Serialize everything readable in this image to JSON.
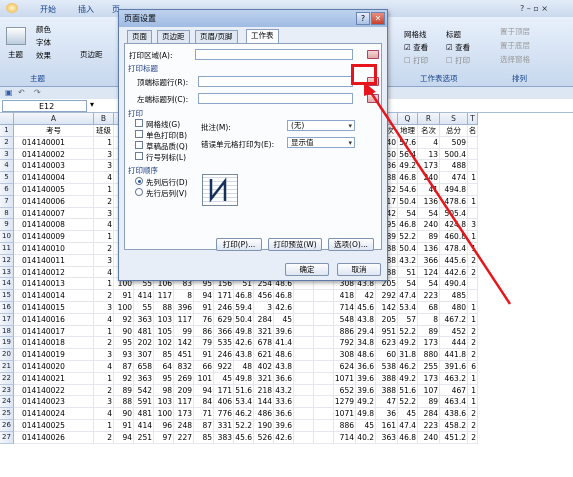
{
  "ribbon": {
    "tabs": [
      "开始",
      "插入",
      "页"
    ],
    "groups": {
      "theme": "主题",
      "sheet_options": "工作表选项",
      "arrange": "排列"
    },
    "theme_btn": "主题",
    "colors": "颜色",
    "fonts": "字体",
    "effects": "效果",
    "margins": "页边距",
    "gridlines": "网格线",
    "headings": "标题",
    "view1": "查看",
    "view2": "查看",
    "print1": "打印",
    "print2": "打印",
    "bring_front": "置于顶层",
    "send_back": "置于底层",
    "selection_pane": "选择窗格"
  },
  "formula_bar": {
    "namebox": "E12"
  },
  "dialog": {
    "title": "页面设置",
    "tabs": [
      "页面",
      "页边距",
      "页眉/页脚",
      "工作表"
    ],
    "print_area": "打印区域(A):",
    "print_titles": "打印标题",
    "top_rows": "顶端标题行(R):",
    "left_cols": "左端标题列(C):",
    "print_section": "打印",
    "gridlines": "网格线(G)",
    "bw": "单色打印(B)",
    "draft": "草稿品质(Q)",
    "rowcol": "行号列标(L)",
    "comments_label": "批注(M):",
    "comments_value": "(无)",
    "errors_label": "错误单元格打印为(E):",
    "errors_value": "显示值",
    "order_section": "打印顺序",
    "down_then_over": "先列后行(D)",
    "over_then_down": "先行后列(V)",
    "print_btn": "打印(P)...",
    "preview_btn": "打印预览(W)",
    "options_btn": "选项(O)...",
    "ok": "确定",
    "cancel": "取消"
  },
  "sheet": {
    "columns": [
      "A",
      "B",
      "C",
      "D",
      "E",
      "F",
      "G",
      "H",
      "I",
      "J",
      "K",
      "L",
      "M",
      "N",
      "O",
      "P",
      "Q",
      "R",
      "S",
      "T"
    ],
    "header_row": [
      "考号",
      "班级",
      "",
      "",
      "",
      "",
      "",
      "",
      "",
      "",
      "",
      "",
      "",
      "名次",
      "历史",
      "名次",
      "地理",
      "名次",
      "总分",
      "名"
    ],
    "rows": [
      [
        "014140001",
        "1",
        "",
        "",
        "",
        "",
        "",
        "",
        "",
        "",
        "",
        "",
        "",
        "571",
        "80.3",
        "340",
        "57.6",
        "4",
        "509",
        ""
      ],
      [
        "014140002",
        "3",
        "",
        "",
        "",
        "",
        "",
        "",
        "",
        "",
        "",
        "",
        "",
        "398",
        "51.4",
        "450",
        "56.4",
        "13",
        "500.4",
        ""
      ],
      [
        "014140003",
        "3",
        "",
        "",
        "",
        "",
        "",
        "",
        "",
        "",
        "",
        "",
        "",
        "548",
        "49.8",
        "36",
        "49.2",
        "173",
        "488",
        ""
      ],
      [
        "014140004",
        "4",
        "",
        "",
        "",
        "",
        "",
        "",
        "",
        "",
        "",
        "",
        "",
        "334",
        "39.8",
        "388",
        "46.8",
        "240",
        "474",
        "1"
      ],
      [
        "014140005",
        "1",
        "",
        "",
        "",
        "",
        "",
        "",
        "",
        "",
        "",
        "",
        "",
        "172",
        "44.4",
        "182",
        "54.6",
        "41",
        "494.8",
        ""
      ],
      [
        "014140006",
        "2",
        "",
        "",
        "",
        "",
        "",
        "",
        "",
        "",
        "",
        "",
        "",
        "930",
        "41.4",
        "317",
        "50.4",
        "136",
        "478.6",
        "1"
      ],
      [
        "014140007",
        "3",
        "",
        "",
        "",
        "",
        "",
        "",
        "",
        "",
        "",
        "",
        "",
        "398",
        "45.6",
        "42",
        "54",
        "54",
        "505.4",
        ""
      ],
      [
        "014140008",
        "4",
        "",
        "",
        "",
        "",
        "",
        "",
        "",
        "",
        "",
        "",
        "",
        "334",
        "29.4",
        "95",
        "46.8",
        "240",
        "424.8",
        "3"
      ],
      [
        "014140009",
        "1",
        "",
        "",
        "",
        "",
        "",
        "",
        "",
        "",
        "",
        "",
        "",
        "418",
        "35.4",
        "589",
        "52.2",
        "89",
        "460.8",
        "1"
      ],
      [
        "014140010",
        "2",
        "",
        "",
        "",
        "",
        "",
        "",
        "",
        "",
        "",
        "",
        "",
        "501",
        "39.6",
        "388",
        "50.4",
        "136",
        "478.4",
        "1"
      ],
      [
        "014140011",
        "3",
        "90",
        "481",
        "100",
        "73",
        "81",
        "497",
        "41.1",
        "431",
        "44.4",
        "",
        "",
        "571",
        "39.6",
        "388",
        "43.2",
        "366",
        "445.6",
        "2"
      ],
      [
        "014140012",
        "4",
        "98",
        "104",
        "59",
        "913",
        "87",
        "331",
        "56.4",
        "48",
        "51.6",
        "",
        "",
        "129",
        "39.6",
        "388",
        "51",
        "124",
        "442.6",
        "2"
      ],
      [
        "014140013",
        "1",
        "100",
        "55",
        "106",
        "83",
        "95",
        "156",
        "51",
        "254",
        "48.6",
        "",
        "",
        "308",
        "43.8",
        "205",
        "54",
        "54",
        "490.4",
        ""
      ],
      [
        "014140014",
        "2",
        "91",
        "414",
        "117",
        "8",
        "94",
        "171",
        "46.8",
        "456",
        "46.8",
        "",
        "",
        "418",
        "42",
        "292",
        "47.4",
        "223",
        "485",
        ""
      ],
      [
        "014140015",
        "3",
        "100",
        "55",
        "88",
        "396",
        "91",
        "246",
        "59.4",
        "3",
        "42.6",
        "",
        "",
        "714",
        "45.6",
        "142",
        "53.4",
        "68",
        "480",
        "1"
      ],
      [
        "014140016",
        "4",
        "92",
        "363",
        "103",
        "117",
        "76",
        "629",
        "50.4",
        "284",
        "45",
        "",
        "",
        "548",
        "43.8",
        "205",
        "57",
        "8",
        "467.2",
        "1"
      ],
      [
        "014140017",
        "1",
        "90",
        "481",
        "105",
        "99",
        "86",
        "366",
        "49.8",
        "321",
        "39.6",
        "",
        "",
        "886",
        "29.4",
        "951",
        "52.2",
        "89",
        "452",
        "2"
      ],
      [
        "014140018",
        "2",
        "95",
        "202",
        "102",
        "142",
        "79",
        "535",
        "42.6",
        "678",
        "41.4",
        "",
        "",
        "792",
        "34.8",
        "623",
        "49.2",
        "173",
        "444",
        "2"
      ],
      [
        "014140019",
        "3",
        "93",
        "307",
        "85",
        "451",
        "91",
        "246",
        "43.8",
        "621",
        "48.6",
        "",
        "",
        "308",
        "48.6",
        "60",
        "31.8",
        "880",
        "441.8",
        "2"
      ],
      [
        "014140020",
        "4",
        "87",
        "658",
        "64",
        "832",
        "66",
        "922",
        "48",
        "402",
        "43.8",
        "",
        "",
        "624",
        "36.6",
        "538",
        "46.2",
        "255",
        "391.6",
        "6"
      ],
      [
        "014140021",
        "1",
        "92",
        "363",
        "95",
        "269",
        "101",
        "45",
        "49.8",
        "321",
        "36.6",
        "",
        "",
        "1071",
        "39.6",
        "388",
        "49.2",
        "173",
        "463.2",
        "1"
      ],
      [
        "014140022",
        "2",
        "89",
        "542",
        "98",
        "209",
        "94",
        "171",
        "51.6",
        "218",
        "43.2",
        "",
        "",
        "652",
        "39.6",
        "388",
        "51.6",
        "107",
        "467",
        "1"
      ],
      [
        "014140023",
        "3",
        "88",
        "591",
        "103",
        "117",
        "84",
        "406",
        "53.4",
        "144",
        "33.6",
        "",
        "",
        "1279",
        "49.2",
        "47",
        "52.2",
        "89",
        "463.4",
        "1"
      ],
      [
        "014140024",
        "4",
        "90",
        "481",
        "100",
        "173",
        "71",
        "776",
        "46.2",
        "486",
        "36.6",
        "",
        "",
        "1071",
        "49.8",
        "36",
        "45",
        "284",
        "438.6",
        "2"
      ],
      [
        "014140025",
        "1",
        "91",
        "414",
        "96",
        "248",
        "87",
        "331",
        "52.2",
        "190",
        "39.6",
        "",
        "",
        "886",
        "45",
        "161",
        "47.4",
        "223",
        "458.2",
        "2"
      ],
      [
        "014140026",
        "2",
        "94",
        "251",
        "97",
        "227",
        "85",
        "383",
        "45.6",
        "526",
        "42.6",
        "",
        "",
        "714",
        "40.2",
        "363",
        "46.8",
        "240",
        "451.2",
        "2"
      ]
    ]
  }
}
